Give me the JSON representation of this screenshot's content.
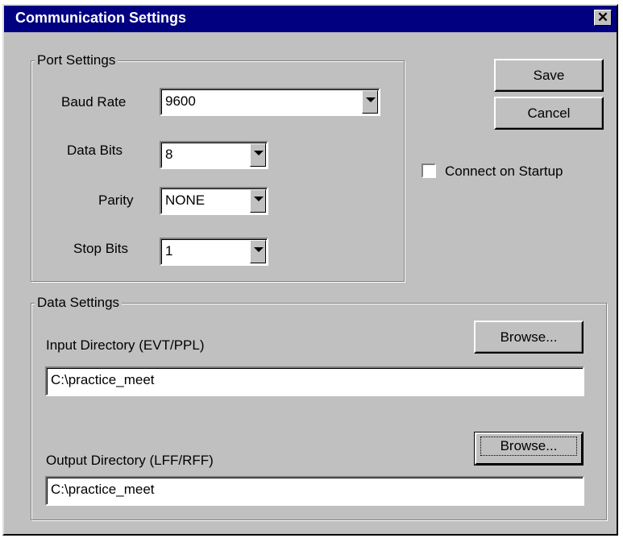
{
  "window": {
    "title": "Communication Settings",
    "close_glyph": "✕"
  },
  "port_settings": {
    "legend": "Port Settings",
    "baud_rate": {
      "label": "Baud Rate",
      "value": "9600"
    },
    "data_bits": {
      "label": "Data Bits",
      "value": "8"
    },
    "parity": {
      "label": "Parity",
      "value": "NONE"
    },
    "stop_bits": {
      "label": "Stop Bits",
      "value": "1"
    }
  },
  "actions": {
    "save_label": "Save",
    "cancel_label": "Cancel"
  },
  "connect_on_startup": {
    "label": "Connect on Startup",
    "checked": false
  },
  "data_settings": {
    "legend": "Data Settings",
    "input_dir": {
      "label": "Input Directory (EVT/PPL)",
      "value": "C:\\practice_meet",
      "browse_label": "Browse..."
    },
    "output_dir": {
      "label": "Output Directory (LFF/RFF)",
      "value": "C:\\practice_meet",
      "browse_label": "Browse..."
    }
  }
}
